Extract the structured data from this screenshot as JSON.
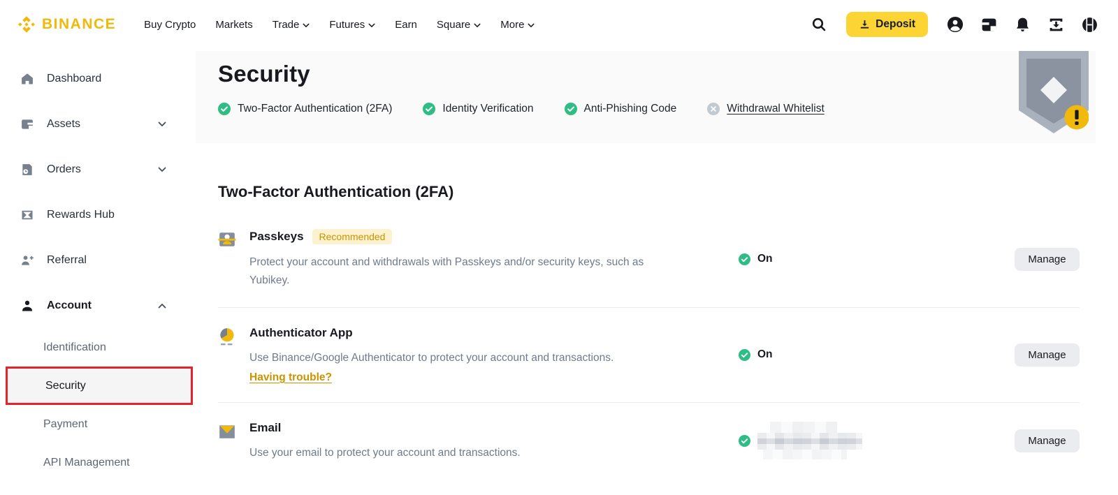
{
  "topbar": {
    "brand": "BINANCE",
    "nav": [
      {
        "label": "Buy Crypto",
        "dropdown": false
      },
      {
        "label": "Markets",
        "dropdown": false
      },
      {
        "label": "Trade",
        "dropdown": true
      },
      {
        "label": "Futures",
        "dropdown": true
      },
      {
        "label": "Earn",
        "dropdown": false
      },
      {
        "label": "Square",
        "dropdown": true
      },
      {
        "label": "More",
        "dropdown": true
      }
    ],
    "deposit_label": "Deposit",
    "icons": [
      "search-icon",
      "profile-icon",
      "wallet-icon",
      "bell-icon",
      "app-download-icon",
      "globe-icon"
    ]
  },
  "sidebar": {
    "items": [
      {
        "label": "Dashboard"
      },
      {
        "label": "Assets",
        "chevron": "down"
      },
      {
        "label": "Orders",
        "chevron": "down"
      },
      {
        "label": "Rewards Hub"
      },
      {
        "label": "Referral"
      },
      {
        "label": "Account",
        "chevron": "up",
        "active": true
      }
    ],
    "account_subitems": [
      {
        "label": "Identification"
      },
      {
        "label": "Security",
        "selected": true
      },
      {
        "label": "Payment"
      },
      {
        "label": "API Management"
      }
    ]
  },
  "header": {
    "title": "Security",
    "statuses": [
      {
        "label": "Two-Factor Authentication (2FA)",
        "state": "ok"
      },
      {
        "label": "Identity Verification",
        "state": "ok"
      },
      {
        "label": "Anti-Phishing Code",
        "state": "ok"
      },
      {
        "label": "Withdrawal Whitelist",
        "state": "off",
        "underlined": true
      }
    ],
    "shield_badge": "!"
  },
  "section": {
    "heading": "Two-Factor Authentication (2FA)",
    "rows": [
      {
        "icon": "passkey-icon",
        "title": "Passkeys",
        "badge": "Recommended",
        "description": "Protect your account and withdrawals with Passkeys and/or security keys, such as Yubikey.",
        "status": "On",
        "action": "Manage"
      },
      {
        "icon": "authenticator-icon",
        "title": "Authenticator App",
        "description": "Use Binance/Google Authenticator to protect your account and transactions.",
        "link": "Having trouble?",
        "status": "On",
        "action": "Manage"
      },
      {
        "icon": "email-icon",
        "title": "Email",
        "description": "Use your email to protect your account and transactions.",
        "status_redacted": true,
        "action": "Manage"
      }
    ]
  },
  "colors": {
    "brand_yellow": "#F0B90B",
    "deposit_yellow": "#FCD535",
    "success_green": "#2EBD85",
    "annotation_red": "#E3252B",
    "badge_text": "#C99400",
    "panel_bg": "#FAFAFA"
  }
}
